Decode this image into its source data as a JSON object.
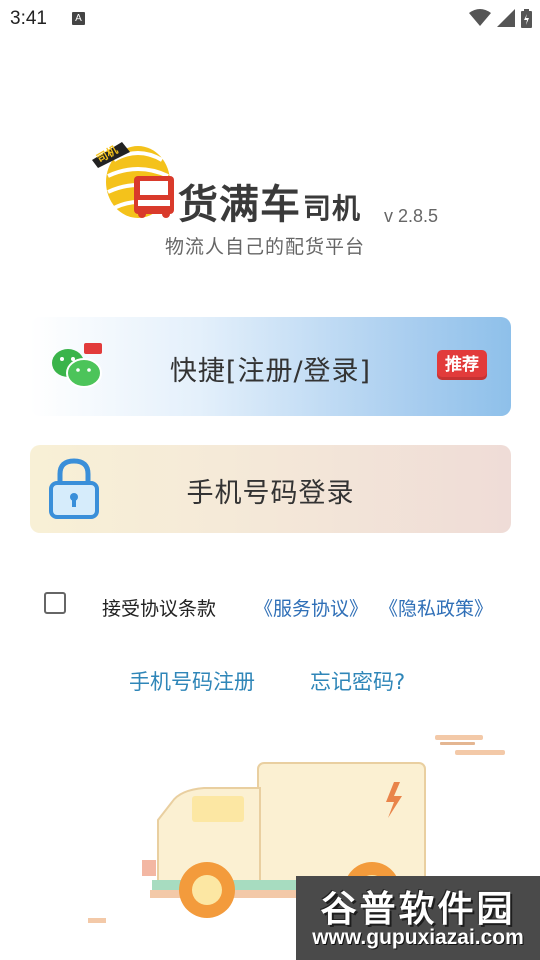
{
  "status_bar": {
    "time": "3:41",
    "notification_letter": "A",
    "icons": [
      "wifi-icon",
      "signal-icon",
      "battery-icon"
    ]
  },
  "brand": {
    "badge": "司机",
    "title": "货满车",
    "role": "司机",
    "version": "v 2.8.5",
    "slogan": "物流人自己的配货平台"
  },
  "quick_login": {
    "label": "快捷[注册/登录]",
    "badge": "推荐",
    "icon": "wechat-icon"
  },
  "phone_login": {
    "label": "手机号码登录",
    "icon": "lock-icon"
  },
  "agreement": {
    "checked": false,
    "text": "接受协议条款",
    "service_link": "《服务协议》",
    "privacy_link": "《隐私政策》"
  },
  "links": {
    "register": "手机号码注册",
    "forgot": "忘记密码?"
  },
  "watermark": {
    "title": "谷普软件园",
    "url": "www.gupuxiazai.com"
  },
  "colors": {
    "link_blue": "#2f6fb7",
    "badge_red": "#e23b3b",
    "brand_yellow": "#f4c21b",
    "truck_red": "#d93a2b"
  }
}
